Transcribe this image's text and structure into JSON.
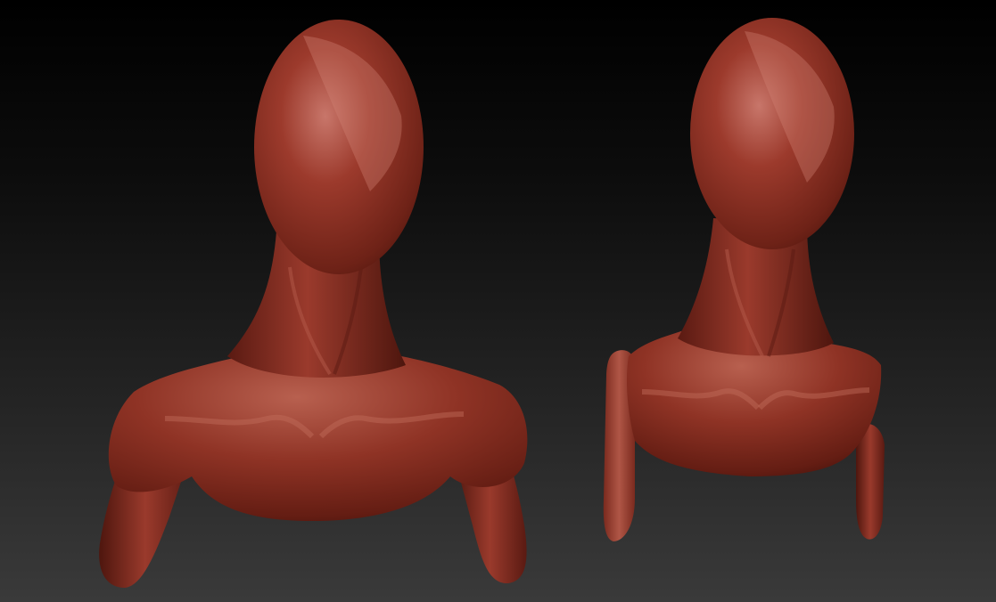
{
  "scene": {
    "background_top": "#000000",
    "background_bottom": "#3a3a3a",
    "material": {
      "base": "#8a2e22",
      "shadow": "#5a1a12",
      "highlight": "#c8766a",
      "rim": "#3e100a"
    },
    "models": [
      {
        "name": "bust-with-arms",
        "description_icon": "sculpt-bust-icon"
      },
      {
        "name": "bust-with-cut-arms",
        "description_icon": "sculpt-bust-icon"
      }
    ]
  }
}
